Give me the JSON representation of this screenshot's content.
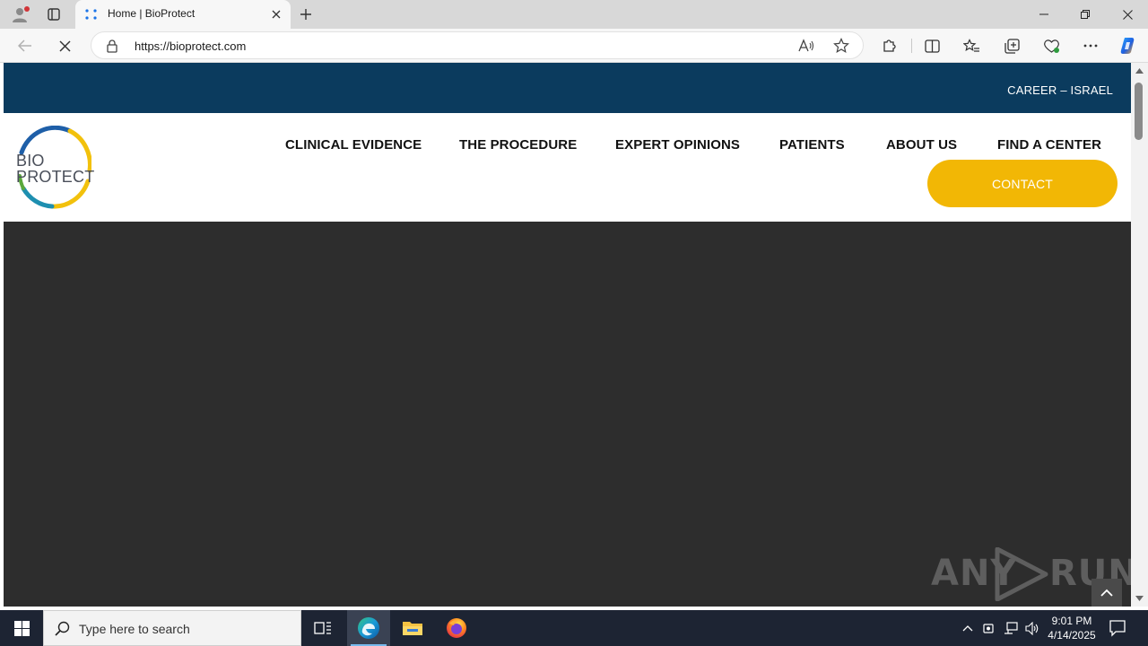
{
  "browser": {
    "tab_title": "Home | BioProtect",
    "url": "https://bioprotect.com"
  },
  "site": {
    "career_link": "CAREER – ISRAEL",
    "logo": {
      "line1": "BIO",
      "line2": "PROTECT"
    },
    "nav": [
      {
        "label": "CLINICAL EVIDENCE"
      },
      {
        "label": "THE PROCEDURE"
      },
      {
        "label": "EXPERT OPINIONS"
      },
      {
        "label": "PATIENTS"
      },
      {
        "label": "ABOUT US"
      },
      {
        "label": "FIND A CENTER"
      }
    ],
    "contact_label": "CONTACT",
    "watermark": {
      "left": "ANY",
      "right": "RUN"
    }
  },
  "taskbar": {
    "search_placeholder": "Type here to search",
    "time": "9:01 PM",
    "date": "4/14/2025"
  },
  "colors": {
    "top_strip": "#0b3b5e",
    "contact": "#f2b705",
    "hero": "#2d2d2d"
  }
}
